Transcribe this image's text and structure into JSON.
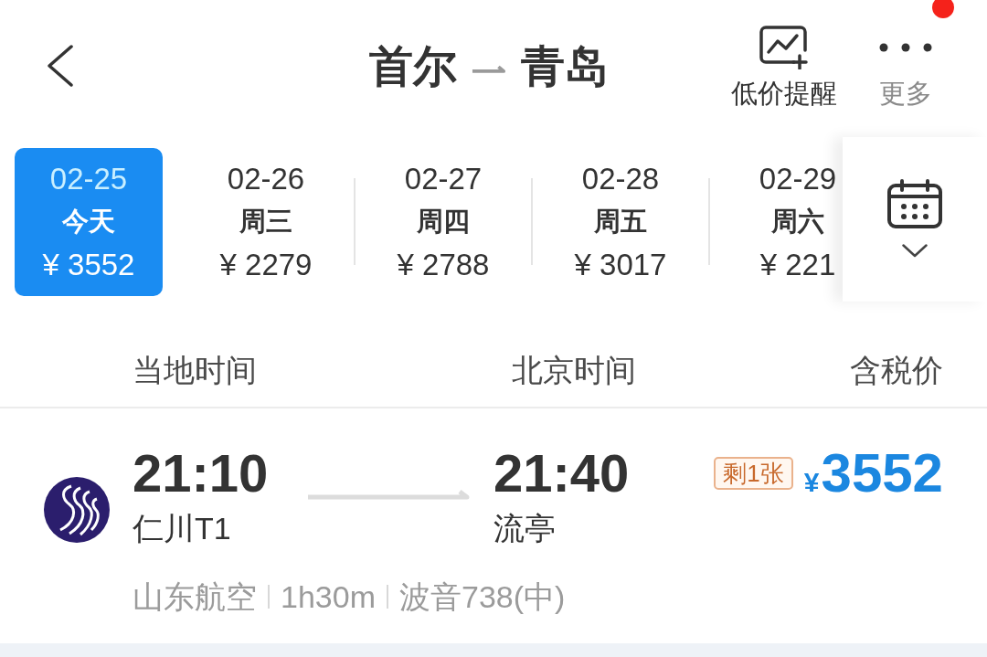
{
  "header": {
    "title": {
      "origin": "首尔",
      "destination": "青岛"
    },
    "actions": [
      {
        "kind": "price-alert",
        "label": "低价提醒",
        "notification": false
      },
      {
        "kind": "more",
        "label": "更多",
        "notification": true
      }
    ]
  },
  "dates": [
    {
      "date": "02-25",
      "weekday": "今天",
      "price": "¥ 3552",
      "selected": true
    },
    {
      "date": "02-26",
      "weekday": "周三",
      "price": "¥ 2279",
      "selected": false
    },
    {
      "date": "02-27",
      "weekday": "周四",
      "price": "¥ 2788",
      "selected": false
    },
    {
      "date": "02-28",
      "weekday": "周五",
      "price": "¥ 3017",
      "selected": false
    },
    {
      "date": "02-29",
      "weekday": "周六",
      "price": "¥ 221",
      "selected": false
    }
  ],
  "fare_table": {
    "columns": [
      "当地时间",
      "北京时间",
      "含税价"
    ]
  },
  "flights": [
    {
      "depart_time": "21:10",
      "depart_airport": "仁川T1",
      "arrive_time": "21:40",
      "arrive_airport": "流亭",
      "tickets_left": "剩1张",
      "currency": "¥",
      "price": "3552",
      "details": [
        "山东航空",
        "1h30m",
        "波音738(中)"
      ]
    }
  ]
}
